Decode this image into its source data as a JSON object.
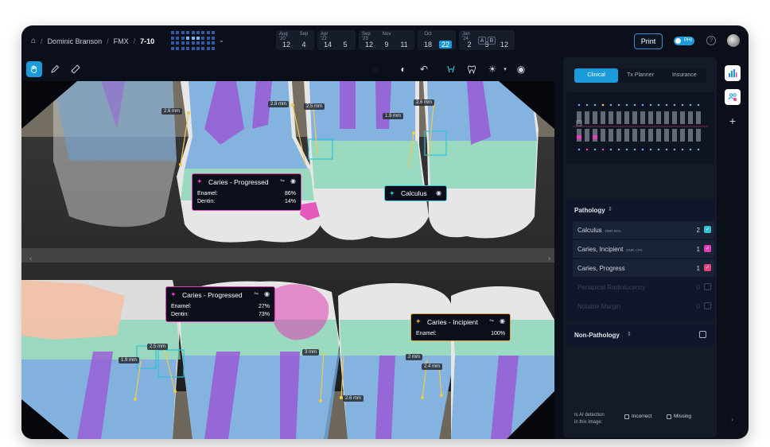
{
  "breadcrumb": {
    "patient": "Dominic Branson",
    "series": "FMX",
    "range": "7-10"
  },
  "timeline": {
    "groups": [
      {
        "cols": [
          {
            "month": "Aug '20",
            "day": "12"
          },
          {
            "month": "Sep",
            "day": "4"
          }
        ]
      },
      {
        "cols": [
          {
            "month": "Apr '22",
            "day": "14"
          },
          {
            "month": "",
            "day": "5"
          }
        ]
      },
      {
        "cols": [
          {
            "month": "Sep '23",
            "day": "12"
          },
          {
            "month": "Nov",
            "day": "9"
          },
          {
            "month": "",
            "day": "11"
          }
        ]
      },
      {
        "cols": [
          {
            "month": "Oct",
            "day": "18"
          },
          {
            "month": "",
            "day": "22",
            "selected": true
          }
        ]
      },
      {
        "cols": [
          {
            "month": "Jan '24",
            "day": "2"
          },
          {
            "month": "",
            "day": "5"
          },
          {
            "month": "",
            "day": "12"
          }
        ]
      }
    ],
    "compare": [
      "A",
      "B"
    ]
  },
  "header": {
    "print_label": "Print",
    "phi_label": "PHI",
    "help_icon": "?"
  },
  "toolbar": {
    "icons": [
      "hand-icon",
      "pen-icon",
      "ruler-icon",
      "spinner-icon",
      "contrast-icon",
      "rotate-icon",
      "tooth-roots-icon",
      "tooth-icon",
      "brightness-icon",
      "eye-icon"
    ]
  },
  "tabs": [
    "Clinical",
    "Tx Planner",
    "Insurance"
  ],
  "pathology": {
    "title": "Pathology",
    "items": [
      {
        "label": "Calculus",
        "meta": "DNR 65%",
        "count": "2",
        "color": "#31c2d6",
        "checked": true
      },
      {
        "label": "Caries, Incipient",
        "meta": "DNR <1%",
        "count": "1",
        "color": "#e23fb6",
        "checked": true
      },
      {
        "label": "Caries, Progress",
        "meta": "",
        "count": "1",
        "color": "#e2457e",
        "checked": true
      },
      {
        "label": "Periapical Radiolucency",
        "meta": "",
        "count": "0",
        "color": "#3c4456",
        "checked": false
      },
      {
        "label": "Notable Margin",
        "meta": "",
        "count": "0",
        "color": "#3c4456",
        "checked": false
      }
    ]
  },
  "non_pathology": {
    "title": "Non-Pathology"
  },
  "feedback": {
    "question_line1": "Is AI detection",
    "question_line2": "in this image:",
    "incorrect": "Incorrect",
    "missing": "Missing"
  },
  "annotations": {
    "caries_upper": {
      "title": "Caries - Progressed",
      "enamel_label": "Enamel:",
      "enamel": "86%",
      "dentin_label": "Dentin:",
      "dentin": "14%"
    },
    "calculus": {
      "title": "Calculus"
    },
    "caries_lower": {
      "title": "Caries - Progressed",
      "enamel_label": "Enamel:",
      "enamel": "27%",
      "dentin_label": "Dentin:",
      "dentin": "73%"
    },
    "caries_incipient": {
      "title": "Caries - Incipient",
      "enamel_label": "Enamel:",
      "enamel": "100%"
    }
  },
  "measurements": [
    "2.6 mm",
    "2.8 mm",
    "2.5 mm",
    "1.9 mm",
    "2.6 mm",
    "2.5 mm",
    "1.9 mm",
    "3 mm",
    "2.6 mm",
    "2 mm",
    "2.4 mm"
  ],
  "colors": {
    "accent": "#1a9ad8",
    "calculus": "#31c2d6",
    "caries": "#e23fb6",
    "incipient": "#e0a23a",
    "enamel_overlay": "#7fd6b4",
    "dentin_overlay": "#6aa6dc",
    "pulp_overlay": "#9a5ad6"
  }
}
